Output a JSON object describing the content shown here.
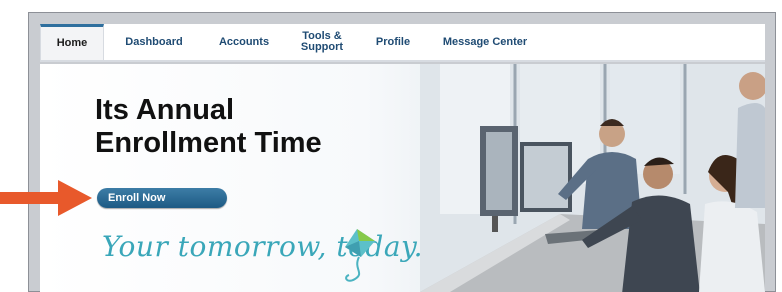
{
  "nav": {
    "tabs": [
      {
        "label": "Home",
        "active": true
      },
      {
        "label": "Dashboard"
      },
      {
        "label": "Accounts"
      },
      {
        "label": "Tools &\nSupport"
      },
      {
        "label": "Profile"
      },
      {
        "label": "Message Center"
      }
    ]
  },
  "hero": {
    "headline_line1": "Its Annual",
    "headline_line2": "Enrollment Time",
    "enroll_button": "Enroll Now",
    "tagline": "Your tomorrow, today."
  },
  "colors": {
    "arrow": "#e8592b",
    "button": "#245f8a",
    "tagline": "#3aa7b9",
    "active_tab_border": "#2e6f9e"
  },
  "icons": [
    "arrow-right-icon",
    "kite-icon"
  ]
}
